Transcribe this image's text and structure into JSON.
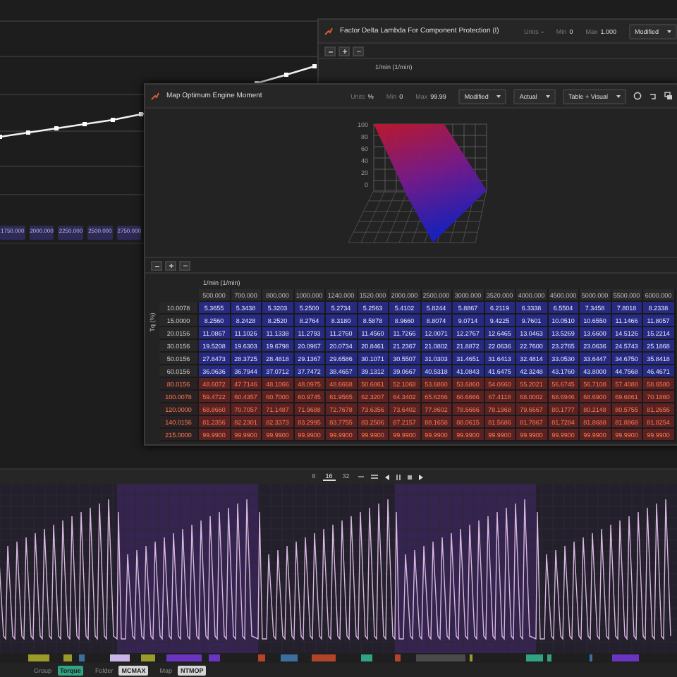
{
  "background_chart": {
    "x_labels": [
      "1750.000",
      "2000.000",
      "2250.000",
      "2500.000",
      "2750.000"
    ]
  },
  "back_window": {
    "title": "Factor Delta Lambda For Component Protection (I)",
    "fields": [
      {
        "label": "Units",
        "value": "-"
      },
      {
        "label": "Min",
        "value": "0"
      },
      {
        "label": "Max",
        "value": "1.000"
      }
    ],
    "dropdown": "Modified",
    "axis_label": "1/min (1/min)"
  },
  "front_window": {
    "title": "Map Optimum Engine Moment",
    "fields": [
      {
        "label": "Units",
        "value": "%"
      },
      {
        "label": "Min",
        "value": "0"
      },
      {
        "label": "Max",
        "value": "99.99"
      }
    ],
    "dropdowns": [
      "Modified",
      "Actual",
      "Table + Visual"
    ],
    "surface": {
      "z_ticks": [
        "100",
        "80",
        "60",
        "40",
        "20",
        "0"
      ]
    },
    "table": {
      "x_axis_label": "1/min (1/min)",
      "y_axis_label": "Tq (%)",
      "columns": [
        "500.000",
        "700.000",
        "800.000",
        "1000.000",
        "1240.000",
        "1520.000",
        "2000.000",
        "2500.000",
        "3000.000",
        "3520.000",
        "4000.000",
        "4500.000",
        "5000.000",
        "5500.000",
        "6000.000"
      ],
      "rows": [
        {
          "label": "10.0078",
          "kind": "low",
          "cells": [
            "5.3655",
            "5.3438",
            "5.3203",
            "5.2500",
            "5.2734",
            "5.2563",
            "5.4102",
            "5.8244",
            "5.8867",
            "6.2119",
            "6.3338",
            "6.5504",
            "7.3458",
            "7.8018",
            "8.2338"
          ]
        },
        {
          "label": "15.0000",
          "kind": "low",
          "cells": [
            "8.2560",
            "8.2428",
            "8.2520",
            "8.2764",
            "8.3180",
            "8.5878",
            "8.9660",
            "8.8074",
            "9.0714",
            "9.4225",
            "9.7601",
            "10.0510",
            "10.6550",
            "11.1466",
            "11.8057"
          ]
        },
        {
          "label": "20.0156",
          "kind": "low",
          "cells": [
            "11.0867",
            "11.1026",
            "11.1338",
            "11.2793",
            "11.2760",
            "11.4560",
            "11.7266",
            "12.0071",
            "12.2767",
            "12.6465",
            "13.0463",
            "13.5269",
            "13.6600",
            "14.5126",
            "15.2214"
          ]
        },
        {
          "label": "30.0156",
          "kind": "low",
          "cells": [
            "19.5208",
            "19.6303",
            "19.6798",
            "20.0967",
            "20.0734",
            "20.8461",
            "21.2367",
            "21.0802",
            "21.8872",
            "22.0636",
            "22.7600",
            "23.2765",
            "23.0636",
            "24.5743",
            "25.1868"
          ]
        },
        {
          "label": "50.0156",
          "kind": "low",
          "cells": [
            "27.8473",
            "28.3725",
            "28.4818",
            "29.1367",
            "29.6586",
            "30.1071",
            "30.5507",
            "31.0303",
            "31.4651",
            "31.6413",
            "32.4814",
            "33.0530",
            "33.6447",
            "34.6750",
            "35.8418"
          ]
        },
        {
          "label": "60.0156",
          "kind": "low",
          "cells": [
            "36.0636",
            "36.7944",
            "37.0712",
            "37.7472",
            "38.4657",
            "39.1312",
            "39.0667",
            "40.5318",
            "41.0843",
            "41.6475",
            "42.3248",
            "43.1760",
            "43.8000",
            "44.7568",
            "46.4671"
          ]
        },
        {
          "label": "80.0156",
          "kind": "high",
          "cells": [
            "48.6072",
            "47.7146",
            "48.1066",
            "48.0975",
            "48.6668",
            "50.6861",
            "52.1068",
            "53.6860",
            "53.6860",
            "54.0660",
            "55.2021",
            "56.6745",
            "56.7108",
            "57.4088",
            "58.6580"
          ]
        },
        {
          "label": "100.0078",
          "kind": "high",
          "cells": [
            "59.4722",
            "60.4357",
            "60.7000",
            "60.9745",
            "61.9565",
            "62.3207",
            "64.3402",
            "65.6266",
            "66.6666",
            "67.4118",
            "68.0002",
            "68.6946",
            "68.6900",
            "69.6861",
            "70.1860"
          ]
        },
        {
          "label": "120.0000",
          "kind": "high",
          "cells": [
            "68.8660",
            "70.7057",
            "71.1487",
            "71.9688",
            "72.7678",
            "73.6356",
            "73.6402",
            "77.8602",
            "78.6666",
            "78.1968",
            "79.6667",
            "80.1777",
            "80.2148",
            "80.5755",
            "81.2656"
          ]
        },
        {
          "label": "140.0156",
          "kind": "high",
          "cells": [
            "81.2356",
            "82.2301",
            "82.3373",
            "83.2995",
            "83.7755",
            "83.2506",
            "87.2157",
            "88.1658",
            "88.0615",
            "81.5686",
            "81.7867",
            "81.7284",
            "81.8688",
            "81.8868",
            "81.8254"
          ]
        },
        {
          "label": "215.0000",
          "kind": "high",
          "cells": [
            "99.9900",
            "99.9900",
            "99.9900",
            "99.9900",
            "99.9900",
            "99.9900",
            "99.9900",
            "99.9900",
            "99.9900",
            "99.9900",
            "99.9900",
            "99.9900",
            "99.9900",
            "99.9900",
            "99.9900"
          ]
        }
      ]
    }
  },
  "timeline": {
    "zoom_options": [
      {
        "label": "8",
        "selected": false
      },
      {
        "label": "16",
        "selected": true
      },
      {
        "label": "32",
        "selected": false
      }
    ]
  },
  "status_bar": [
    {
      "label": "Group",
      "value": "Torque",
      "color": "#2fa383"
    },
    {
      "label": "Folder",
      "value": "MCMAX",
      "color": "#d4d4d4"
    },
    {
      "label": "Map",
      "value": "NTMOP",
      "color": "#d4d4d4"
    }
  ]
}
